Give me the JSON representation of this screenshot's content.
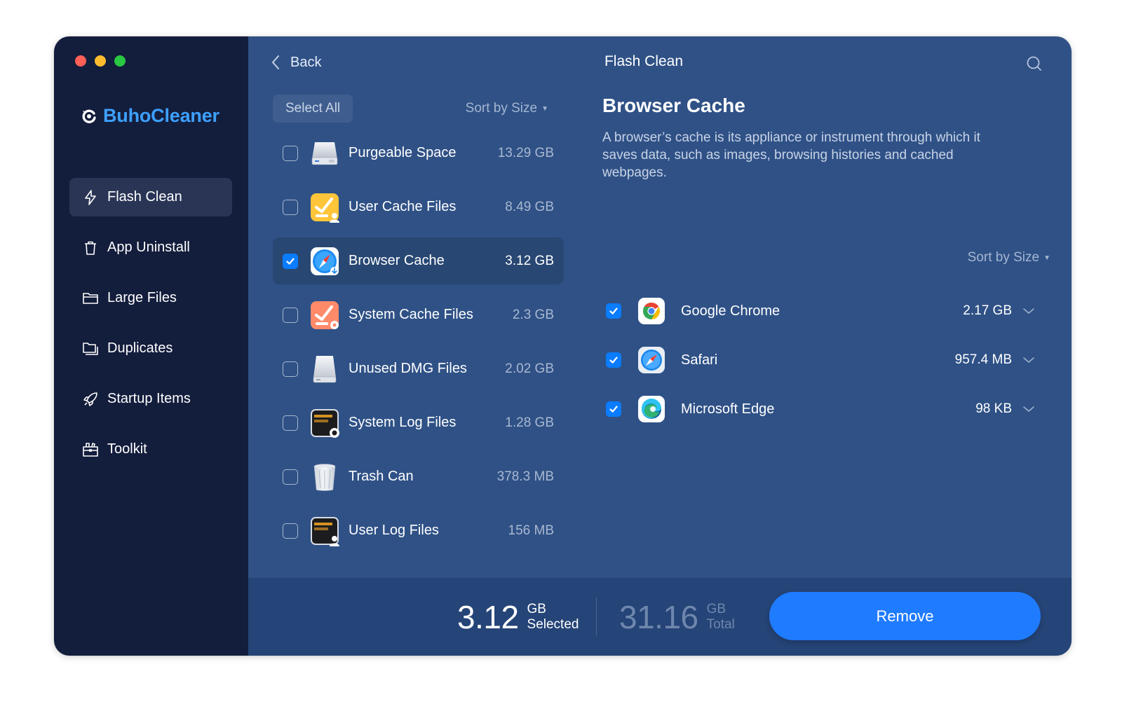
{
  "app": {
    "brand": "BuhoCleaner"
  },
  "sidebar": {
    "items": [
      {
        "label": "Flash Clean",
        "icon": "bolt-icon",
        "active": true
      },
      {
        "label": "App Uninstall",
        "icon": "trash-icon",
        "active": false
      },
      {
        "label": "Large Files",
        "icon": "folder-icon",
        "active": false
      },
      {
        "label": "Duplicates",
        "icon": "duplicate-folder-icon",
        "active": false
      },
      {
        "label": "Startup Items",
        "icon": "rocket-icon",
        "active": false
      },
      {
        "label": "Toolkit",
        "icon": "toolbox-icon",
        "active": false
      }
    ]
  },
  "header": {
    "back_label": "Back",
    "title": "Flash Clean"
  },
  "list": {
    "select_all_label": "Select All",
    "sort_label": "Sort by Size",
    "items": [
      {
        "label": "Purgeable Space",
        "size": "13.29 GB",
        "icon": "disk-icon",
        "checked": false
      },
      {
        "label": "User Cache Files",
        "size": "8.49 GB",
        "icon": "user-cache-icon",
        "checked": false
      },
      {
        "label": "Browser Cache",
        "size": "3.12 GB",
        "icon": "browser-cache-icon",
        "checked": true
      },
      {
        "label": "System Cache Files",
        "size": "2.3 GB",
        "icon": "system-cache-icon",
        "checked": false
      },
      {
        "label": "Unused DMG Files",
        "size": "2.02 GB",
        "icon": "dmg-disk-icon",
        "checked": false
      },
      {
        "label": "System Log Files",
        "size": "1.28 GB",
        "icon": "system-log-icon",
        "checked": false
      },
      {
        "label": "Trash Can",
        "size": "378.3 MB",
        "icon": "trash-can-icon",
        "checked": false
      },
      {
        "label": "User Log Files",
        "size": "156 MB",
        "icon": "user-log-icon",
        "checked": false
      }
    ]
  },
  "detail": {
    "title": "Browser Cache",
    "description": "A browser’s cache is its appliance or instrument through which it saves data, such as images, browsing histories and cached webpages.",
    "sort_label": "Sort by Size",
    "apps": [
      {
        "name": "Google Chrome",
        "size": "2.17 GB",
        "icon": "chrome-icon",
        "checked": true
      },
      {
        "name": "Safari",
        "size": "957.4 MB",
        "icon": "safari-icon",
        "checked": true
      },
      {
        "name": "Microsoft Edge",
        "size": "98 KB",
        "icon": "edge-icon",
        "checked": true
      }
    ]
  },
  "footer": {
    "selected_value": "3.12",
    "selected_unit": "GB",
    "selected_label": "Selected",
    "total_value": "31.16",
    "total_unit": "GB",
    "total_label": "Total",
    "remove_label": "Remove"
  },
  "colors": {
    "sidebar_bg": "#131d3c",
    "main_bg": "#2f5186",
    "footer_bg": "#254477",
    "accent": "#1f7bff",
    "brand": "#3da0ff"
  }
}
